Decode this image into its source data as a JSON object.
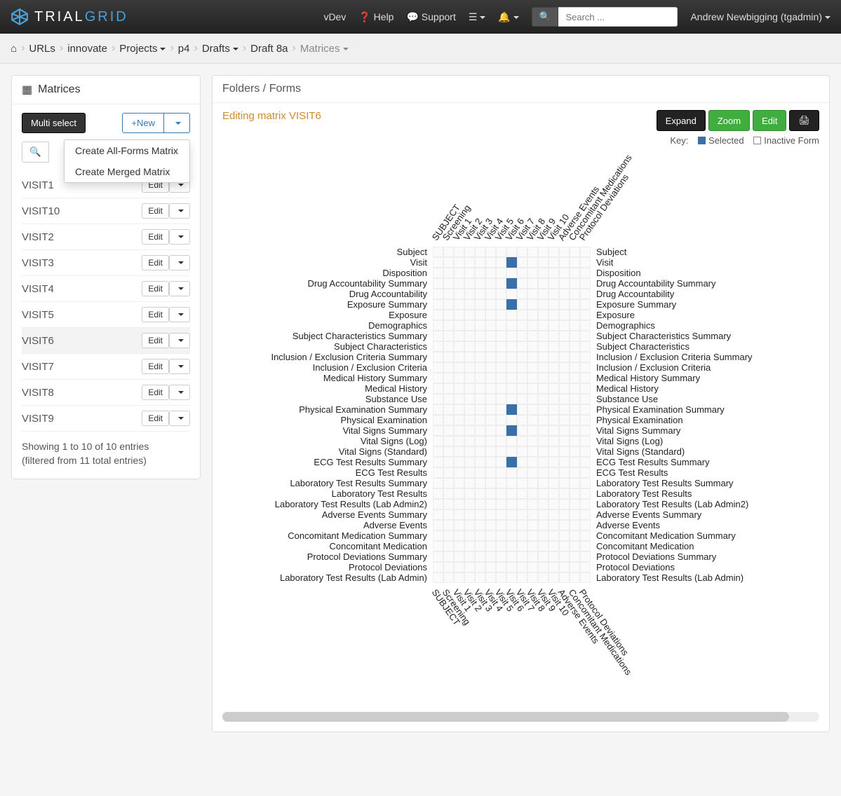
{
  "nav": {
    "brand_left": "TRIAL",
    "brand_right": "GRID",
    "vdev": "vDev",
    "help": "Help",
    "support": "Support",
    "search_placeholder": "Search ...",
    "user": "Andrew Newbigging (tgadmin)"
  },
  "breadcrumb": {
    "urls": "URLs",
    "innovate": "innovate",
    "projects": "Projects",
    "p4": "p4",
    "drafts": "Drafts",
    "draft8a": "Draft 8a",
    "matrices": "Matrices"
  },
  "sidebar": {
    "title": "Matrices",
    "multi_select": "Multi select",
    "new_label": "New",
    "dropdown": {
      "create_all": "Create All-Forms Matrix",
      "create_merged": "Create Merged Matrix"
    },
    "items": [
      {
        "name": "VISIT1",
        "edit": "Edit"
      },
      {
        "name": "VISIT10",
        "edit": "Edit"
      },
      {
        "name": "VISIT2",
        "edit": "Edit"
      },
      {
        "name": "VISIT3",
        "edit": "Edit"
      },
      {
        "name": "VISIT4",
        "edit": "Edit"
      },
      {
        "name": "VISIT5",
        "edit": "Edit"
      },
      {
        "name": "VISIT6",
        "edit": "Edit",
        "selected": true
      },
      {
        "name": "VISIT7",
        "edit": "Edit"
      },
      {
        "name": "VISIT8",
        "edit": "Edit"
      },
      {
        "name": "VISIT9",
        "edit": "Edit"
      }
    ],
    "footer_line1": "Showing 1 to 10 of 10 entries",
    "footer_line2": "(filtered from 11 total entries)"
  },
  "content": {
    "heading": "Folders / Forms",
    "editing": "Editing matrix VISIT6",
    "expand": "Expand",
    "zoom": "Zoom",
    "edit": "Edit",
    "key_label": "Key:",
    "key_selected": "Selected",
    "key_inactive": "Inactive Form"
  },
  "chart_data": {
    "type": "heatmap",
    "columns": [
      "SUBJECT",
      "Screening",
      "Visit 1",
      "Visit 2",
      "Visit 3",
      "Visit 4",
      "Visit 5",
      "Visit 6",
      "Visit 7",
      "Visit 8",
      "Visit 9",
      "Visit 10",
      "Adverse Events",
      "Concomitant Medications",
      "Protocol Deviations"
    ],
    "rows": [
      "Subject",
      "Visit",
      "Disposition",
      "Drug Accountability Summary",
      "Drug Accountability",
      "Exposure Summary",
      "Exposure",
      "Demographics",
      "Subject Characteristics Summary",
      "Subject Characteristics",
      "Inclusion / Exclusion Criteria Summary",
      "Inclusion / Exclusion Criteria",
      "Medical History Summary",
      "Medical History",
      "Substance Use",
      "Physical Examination Summary",
      "Physical Examination",
      "Vital Signs Summary",
      "Vital Signs (Log)",
      "Vital Signs (Standard)",
      "ECG Test Results Summary",
      "ECG Test Results",
      "Laboratory Test Results Summary",
      "Laboratory Test Results",
      "Laboratory Test Results (Lab Admin2)",
      "Adverse Events Summary",
      "Adverse Events",
      "Concomitant Medication Summary",
      "Concomitant Medication",
      "Protocol Deviations Summary",
      "Protocol Deviations",
      "Laboratory Test Results (Lab Admin)"
    ],
    "selected": [
      {
        "row": 1,
        "col": 7
      },
      {
        "row": 3,
        "col": 7
      },
      {
        "row": 5,
        "col": 7
      },
      {
        "row": 15,
        "col": 7
      },
      {
        "row": 17,
        "col": 7
      },
      {
        "row": 20,
        "col": 7
      }
    ]
  }
}
